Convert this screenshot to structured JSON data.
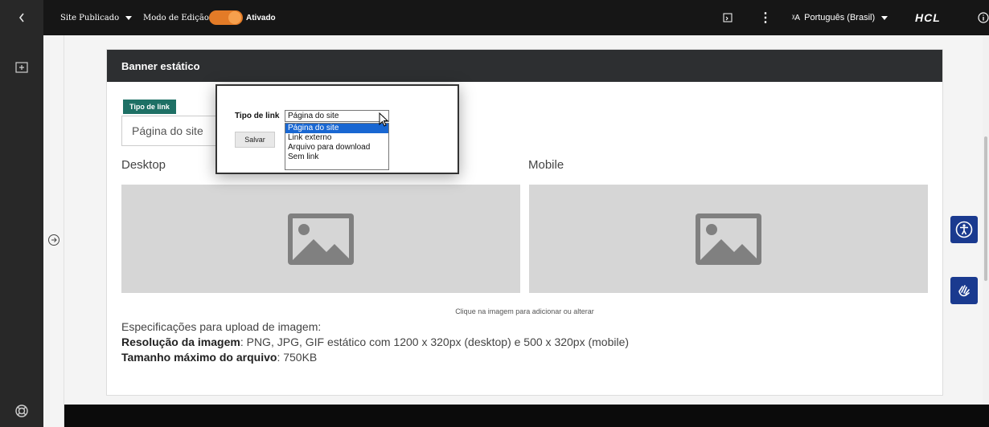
{
  "topbar": {
    "site_status": "Site Publicado",
    "edit_mode_label": "Modo de Edição:",
    "edit_mode_value": "Ativado",
    "language": "Português (Brasil)",
    "brand": "HCL"
  },
  "card": {
    "title": "Banner estático",
    "link_type_tag": "Tipo de link",
    "link_type_value": "Página do site",
    "desktop_label": "Desktop",
    "mobile_label": "Mobile",
    "image_hint": "Clique na imagem para adicionar ou alterar",
    "specs_title": "Especificações para upload de imagem:",
    "resolution_label": "Resolução da imagem",
    "resolution_value": ": PNG, JPG, GIF estático com 1200 x 320px (desktop) e 500 x 320px (mobile)",
    "max_size_label": "Tamanho máximo do arquivo",
    "max_size_value": ": 750KB"
  },
  "popup": {
    "label": "Tipo de link",
    "selected": "Página do site",
    "options": [
      "Página do site",
      "Link externo",
      "Arquivo para download",
      "Sem link"
    ],
    "save_label": "Salvar"
  },
  "colors": {
    "accent_toggle": "#e37b27",
    "tag_green": "#1e7065",
    "header_dark": "#2d2f31",
    "accessibility_blue": "#1a3a8f"
  }
}
